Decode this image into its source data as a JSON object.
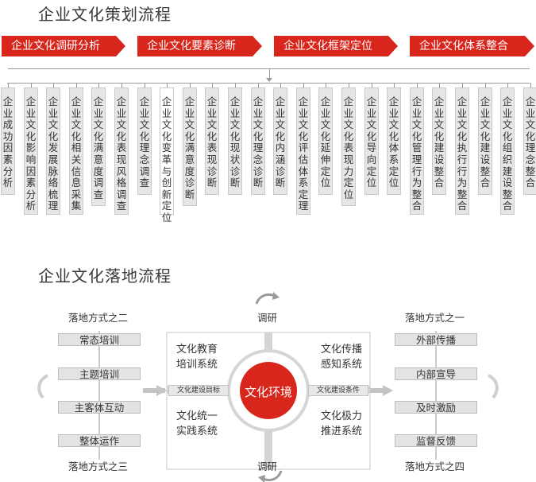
{
  "planning": {
    "title": "企业文化策划流程",
    "phases": [
      "企业文化调研分析",
      "企业文化要素诊断",
      "企业文化框架定位",
      "企业文化体系整合"
    ],
    "columns": [
      "企业成功因素分析",
      "企业文化影响因素分析",
      "企业文化发展脉络梳理",
      "企业文化相关信息采集",
      "企业文化满意度调查",
      "企业文化表现风格调查",
      "企业文化理念调查",
      "企业文化变革与创新定位",
      "企业文化满意度诊断",
      "企业文化表现诊断",
      "企业文化现状诊断",
      "企业文化理念诊断",
      "企业文化内涵诊断",
      "企业文化评估体系定理",
      "企业文化延伸定位",
      "企业文化表现力定位",
      "企业文化导向定位",
      "企业文化体系定位",
      "企业文化管理行为整合",
      "企业文化建设整合",
      "企业文化执行行为整合",
      "企业文化建设整合",
      "企业文化组织建设整合",
      "企业文化理念整合"
    ]
  },
  "landing": {
    "title": "企业文化落地流程",
    "top_label": "调研",
    "bottom_label": "调研",
    "center_label": "文化环境",
    "quadrants": {
      "top_left": [
        "文化教育",
        "培训系统"
      ],
      "top_right": [
        "文化传播",
        "感知系统"
      ],
      "bottom_left": [
        "文化统一",
        "实践系统"
      ],
      "bottom_right": [
        "文化极力",
        "推进系统"
      ]
    },
    "left_bar_label": "文化建设目标",
    "right_bar_label": "文化建设条件",
    "left": {
      "top_caption": "落地方式之二",
      "bottom_caption": "落地方式之三",
      "steps": [
        "常态培训",
        "主题培训",
        "主客体互动",
        "整体运作"
      ]
    },
    "right": {
      "top_caption": "落地方式之一",
      "bottom_caption": "落地方式之四",
      "steps": [
        "外部传播",
        "内部宣导",
        "及时激励",
        "监督反馈"
      ]
    }
  },
  "colors": {
    "accent": "#d9261c",
    "box_gray": "#e6e6e6",
    "line_gray": "#9a9a9a"
  }
}
